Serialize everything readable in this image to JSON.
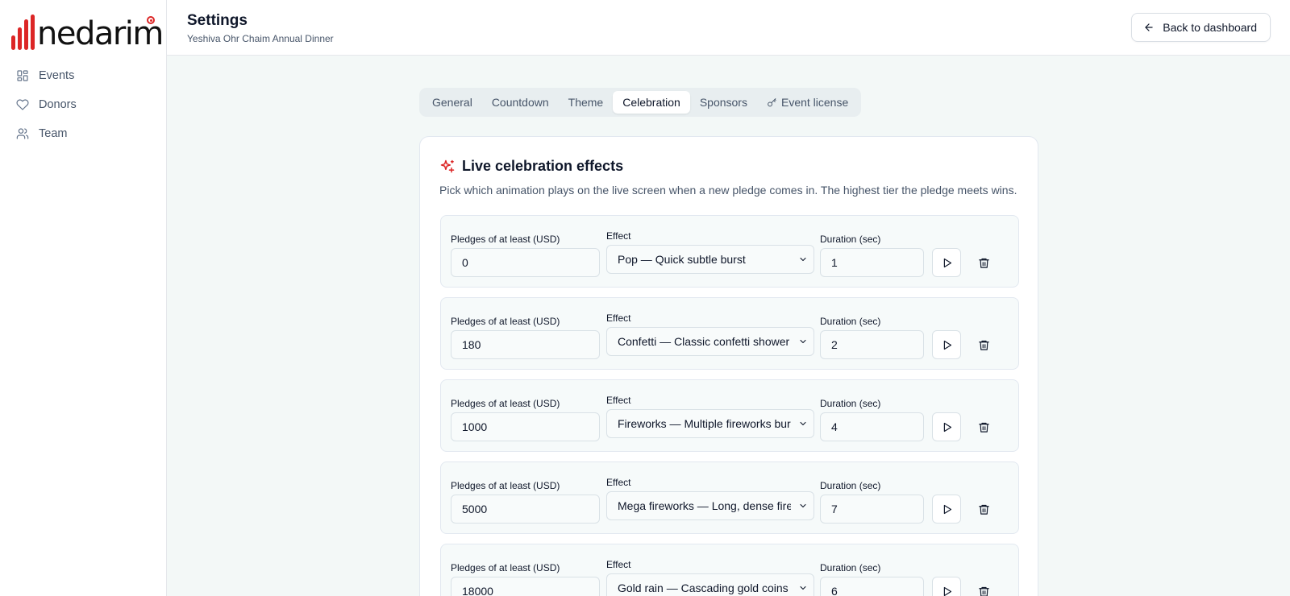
{
  "brand": {
    "name": "nedarim",
    "accent": "#dc2626"
  },
  "sidebar": {
    "items": [
      {
        "label": "Events",
        "icon": "grid-icon"
      },
      {
        "label": "Donors",
        "icon": "heart-icon"
      },
      {
        "label": "Team",
        "icon": "users-icon"
      }
    ]
  },
  "header": {
    "title": "Settings",
    "subtitle": "Yeshiva Ohr Chaim Annual Dinner",
    "back_label": "Back to dashboard"
  },
  "tabs": [
    {
      "label": "General"
    },
    {
      "label": "Countdown"
    },
    {
      "label": "Theme"
    },
    {
      "label": "Celebration",
      "active": true
    },
    {
      "label": "Sponsors"
    },
    {
      "label": "Event license",
      "icon": "key-icon"
    }
  ],
  "celebration": {
    "title": "Live celebration effects",
    "description": "Pick which animation plays on the live screen when a new pledge comes in. The highest tier the pledge meets wins.",
    "labels": {
      "min": "Pledges of at least (USD)",
      "effect": "Effect",
      "duration": "Duration (sec)"
    },
    "tiers": [
      {
        "min": "0",
        "effect": "Pop — Quick subtle burst",
        "duration": "1"
      },
      {
        "min": "180",
        "effect": "Confetti — Classic confetti shower",
        "duration": "2"
      },
      {
        "min": "1000",
        "effect": "Fireworks — Multiple fireworks bursts",
        "duration": "4"
      },
      {
        "min": "5000",
        "effect": "Mega fireworks — Long, dense fireworks",
        "duration": "7"
      },
      {
        "min": "18000",
        "effect": "Gold rain — Cascading gold coins",
        "duration": "6"
      }
    ]
  }
}
